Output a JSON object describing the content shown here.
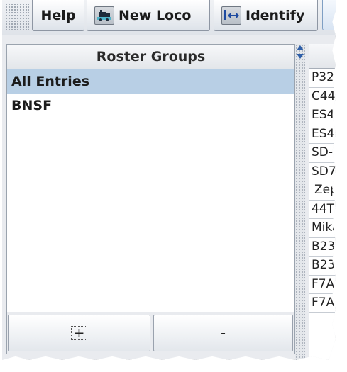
{
  "toolbar": {
    "help_label": "Help",
    "new_loco_label": "New Loco",
    "identify_label": "Identify",
    "icons": {
      "new_loco": "locomotive-icon",
      "identify": "identify-arrows-icon"
    }
  },
  "roster_groups": {
    "header": "Roster Groups",
    "items": [
      {
        "label": "All Entries",
        "selected": true
      },
      {
        "label": "BNSF",
        "selected": false
      }
    ],
    "add_label": "+",
    "remove_label": "-"
  },
  "roster_table": {
    "rows": [
      "P32",
      "C44",
      "ES4",
      "ES4",
      "SD-",
      "SD7",
      "Zep",
      "44T",
      "Mika",
      "B23",
      "B23",
      "F7A",
      "F7A"
    ]
  },
  "colors": {
    "selection": "#b8cfe5",
    "accent_arrow": "#2f5fa8"
  }
}
